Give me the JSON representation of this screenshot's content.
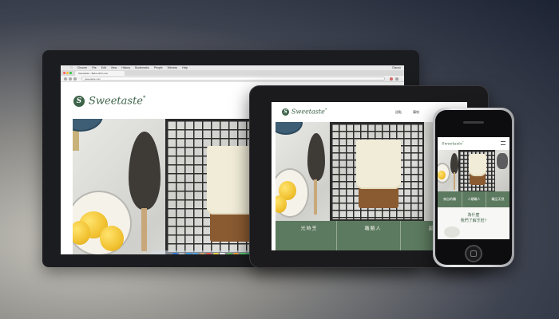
{
  "mac_menu": {
    "items": [
      "Chrome",
      "File",
      "Edit",
      "View",
      "History",
      "Bookmarks",
      "People",
      "Window",
      "Help"
    ],
    "right": "Discou"
  },
  "browser": {
    "tab_title": "Sweetaste - Bake with Love",
    "url": "sweetaste.com"
  },
  "brand": {
    "logo_letter": "S",
    "name": "Sweetaste",
    "star": "*",
    "color_green": "#3d6349",
    "band_green": "#5c7a5f"
  },
  "tablet": {
    "nav": [
      "甜點",
      "購物"
    ],
    "band_texts": [
      "烹\n時\n光",
      "人\n類\n職",
      "都\n是"
    ]
  },
  "phone": {
    "tiles": [
      "來自的職",
      "人類職人",
      "職品天然"
    ],
    "tagline_line1": "為什麼",
    "tagline_line2": "我們了解烹飪?"
  },
  "dock": {
    "icons": [
      "finder-icon",
      "launchpad-icon",
      "safari-icon",
      "mail-icon",
      "contacts-icon",
      "calendar-icon",
      "notes-icon",
      "reminders-icon",
      "maps-icon",
      "photos-icon",
      "messages-icon",
      "facetime-icon",
      "itunes-icon",
      "ibooks-icon",
      "appstore-icon",
      "preferences-icon",
      "chrome-icon",
      "terminal-icon",
      "folder-icon",
      "trash-icon"
    ],
    "colors": [
      "#2f7bd6",
      "#b7c2cc",
      "#3aa0e8",
      "#5aa3e6",
      "#c9a06b",
      "#e85a4f",
      "#f2d24a",
      "#f4f4f4",
      "#5cb85c",
      "#e8a33a",
      "#4cd964",
      "#2ecc71",
      "#d94ad6",
      "#f08c2e",
      "#3b8de0",
      "#8e8e93",
      "#e7463a",
      "#2b2b2b",
      "#6aa9e0",
      "#b0b3b8"
    ]
  }
}
